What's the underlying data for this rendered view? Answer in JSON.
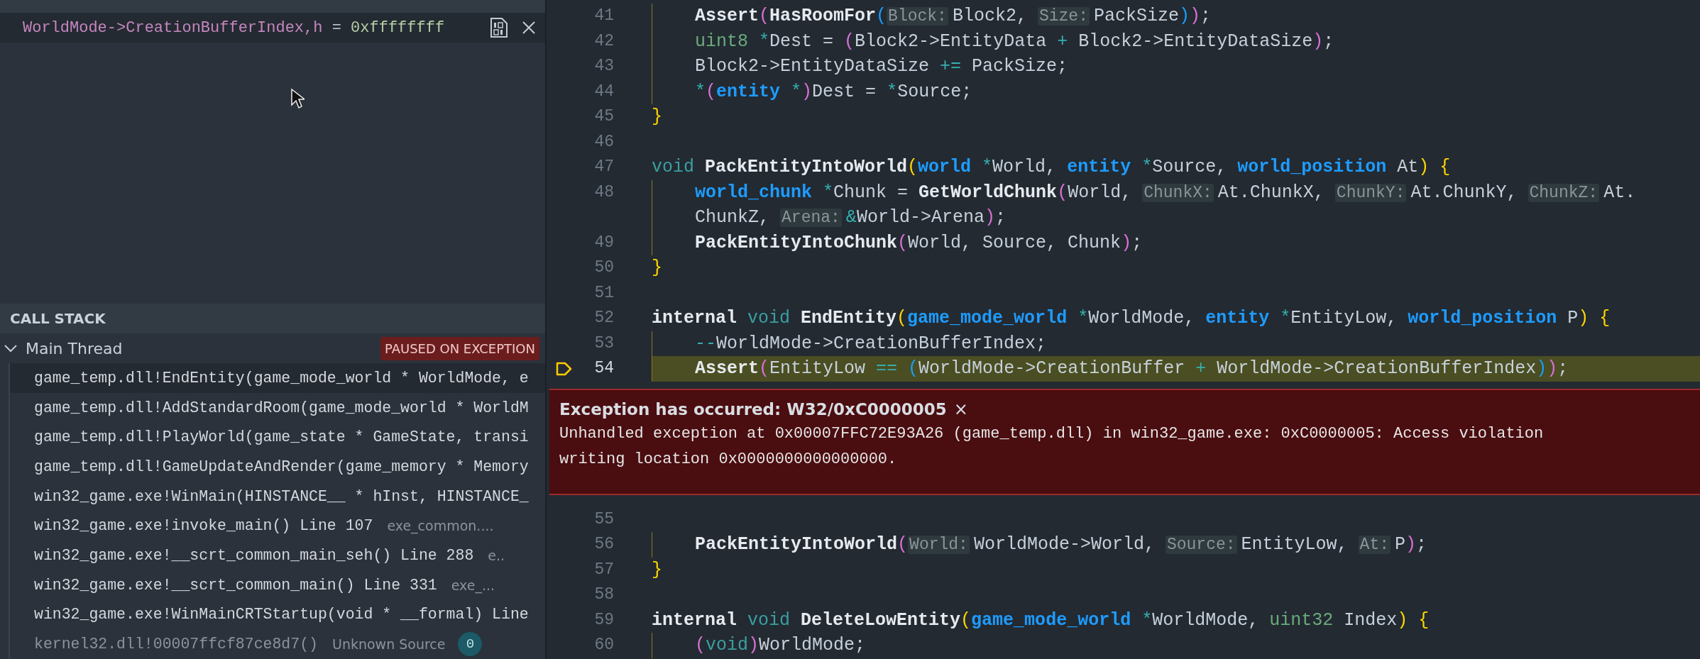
{
  "watch": {
    "expression": "WorldMode->CreationBufferIndex,h",
    "separator": "=",
    "value": "0xffffffff"
  },
  "call_stack": {
    "title": "CALL STACK",
    "threads": [
      {
        "name": "Main Thread",
        "expanded": true,
        "status": "PAUSED ON EXCEPTION",
        "frames": [
          {
            "name": "game_temp.dll!EndEntity(game_mode_world * WorldMode, e",
            "selected": true,
            "deemphasized": false
          },
          {
            "name": "game_temp.dll!AddStandardRoom(game_mode_world * WorldM",
            "selected": false,
            "deemphasized": false
          },
          {
            "name": "game_temp.dll!PlayWorld(game_state * GameState, transi",
            "selected": false,
            "deemphasized": false
          },
          {
            "name": "game_temp.dll!GameUpdateAndRender(game_memory * Memory",
            "selected": false,
            "deemphasized": false
          },
          {
            "name": "win32_game.exe!WinMain(HINSTANCE__ * hInst, HINSTANCE_",
            "selected": false,
            "deemphasized": false
          },
          {
            "name": "win32_game.exe!invoke_main() Line 107",
            "source": "exe_common....",
            "selected": false,
            "deemphasized": false
          },
          {
            "name": "win32_game.exe!__scrt_common_main_seh() Line 288",
            "source": "e..",
            "selected": false,
            "deemphasized": false
          },
          {
            "name": "win32_game.exe!__scrt_common_main() Line 331",
            "source": "exe_...",
            "selected": false,
            "deemphasized": false
          },
          {
            "name": "win32_game.exe!WinMainCRTStartup(void * __formal) Line",
            "selected": false,
            "deemphasized": false
          },
          {
            "name": "kernel32.dll!00007ffcf87ce8d7()",
            "source": "Unknown Source",
            "badge": "0",
            "selected": false,
            "deemphasized": true
          }
        ]
      }
    ]
  },
  "editor": {
    "lines": [
      {
        "number": "41",
        "tokens": [
          {
            "kind": "fn",
            "text": "    Assert"
          },
          {
            "kind": "p2",
            "text": "("
          },
          {
            "kind": "fn",
            "text": "HasRoomFor"
          },
          {
            "kind": "p3",
            "text": "("
          },
          {
            "kind": "hint",
            "text": "Block:"
          },
          {
            "kind": "plain",
            "text": "Block2, "
          },
          {
            "kind": "hint",
            "text": "Size:"
          },
          {
            "kind": "plain",
            "text": "PackSize"
          },
          {
            "kind": "p3",
            "text": ")"
          },
          {
            "kind": "p2",
            "text": ")"
          },
          {
            "kind": "plain",
            "text": ";"
          }
        ]
      },
      {
        "number": "42",
        "tokens": [
          {
            "kind": "prim",
            "text": "    uint8"
          },
          {
            "kind": "op",
            "text": " *"
          },
          {
            "kind": "plain",
            "text": "Dest = "
          },
          {
            "kind": "p2",
            "text": "("
          },
          {
            "kind": "plain",
            "text": "Block2->EntityData "
          },
          {
            "kind": "op",
            "text": "+"
          },
          {
            "kind": "plain",
            "text": " Block2->EntityDataSize"
          },
          {
            "kind": "p2",
            "text": ")"
          },
          {
            "kind": "plain",
            "text": ";"
          }
        ]
      },
      {
        "number": "43",
        "tokens": [
          {
            "kind": "plain",
            "text": "    Block2->EntityDataSize "
          },
          {
            "kind": "op",
            "text": "+="
          },
          {
            "kind": "plain",
            "text": " PackSize;"
          }
        ]
      },
      {
        "number": "44",
        "tokens": [
          {
            "kind": "op",
            "text": "    *"
          },
          {
            "kind": "p2",
            "text": "("
          },
          {
            "kind": "type",
            "text": "entity"
          },
          {
            "kind": "op",
            "text": " *"
          },
          {
            "kind": "p2",
            "text": ")"
          },
          {
            "kind": "plain",
            "text": "Dest = "
          },
          {
            "kind": "op",
            "text": "*"
          },
          {
            "kind": "plain",
            "text": "Source;"
          }
        ]
      },
      {
        "number": "45",
        "tokens": [
          {
            "kind": "p1",
            "text": "}"
          }
        ]
      },
      {
        "number": "46"
      },
      {
        "number": "47",
        "tokens": [
          {
            "kind": "void",
            "text": "void "
          },
          {
            "kind": "fn",
            "text": "PackEntityIntoWorld"
          },
          {
            "kind": "p1",
            "text": "("
          },
          {
            "kind": "type",
            "text": "world"
          },
          {
            "kind": "op",
            "text": " *"
          },
          {
            "kind": "plain",
            "text": "World, "
          },
          {
            "kind": "type",
            "text": "entity"
          },
          {
            "kind": "op",
            "text": " *"
          },
          {
            "kind": "plain",
            "text": "Source, "
          },
          {
            "kind": "type",
            "text": "world_position"
          },
          {
            "kind": "plain",
            "text": " At"
          },
          {
            "kind": "p1",
            "text": ")"
          },
          {
            "kind": "p1",
            "text": " {"
          }
        ]
      },
      {
        "number": "48",
        "tokens": [
          {
            "kind": "type",
            "text": "    world_chunk"
          },
          {
            "kind": "op",
            "text": " *"
          },
          {
            "kind": "plain",
            "text": "Chunk = "
          },
          {
            "kind": "fn",
            "text": "GetWorldChunk"
          },
          {
            "kind": "p2",
            "text": "("
          },
          {
            "kind": "plain",
            "text": "World, "
          },
          {
            "kind": "hint",
            "text": "ChunkX:"
          },
          {
            "kind": "plain",
            "text": "At.ChunkX, "
          },
          {
            "kind": "hint",
            "text": "ChunkY:"
          },
          {
            "kind": "plain",
            "text": "At.ChunkY, "
          },
          {
            "kind": "hint",
            "text": "ChunkZ:"
          },
          {
            "kind": "plain",
            "text": "At."
          }
        ],
        "continuation": [
          {
            "kind": "plain",
            "text": "    ChunkZ, "
          },
          {
            "kind": "hint",
            "text": "Arena:"
          },
          {
            "kind": "op",
            "text": "&"
          },
          {
            "kind": "plain",
            "text": "World->Arena"
          },
          {
            "kind": "p2",
            "text": ")"
          },
          {
            "kind": "plain",
            "text": ";"
          }
        ]
      },
      {
        "number": "49",
        "tokens": [
          {
            "kind": "fn",
            "text": "    PackEntityIntoChunk"
          },
          {
            "kind": "p2",
            "text": "("
          },
          {
            "kind": "plain",
            "text": "World, Source, Chunk"
          },
          {
            "kind": "p2",
            "text": ")"
          },
          {
            "kind": "plain",
            "text": ";"
          }
        ]
      },
      {
        "number": "50",
        "tokens": [
          {
            "kind": "p1",
            "text": "}"
          }
        ]
      },
      {
        "number": "51"
      },
      {
        "number": "52",
        "tokens": [
          {
            "kind": "kw",
            "text": "internal "
          },
          {
            "kind": "void",
            "text": "void "
          },
          {
            "kind": "fn",
            "text": "EndEntity"
          },
          {
            "kind": "p1",
            "text": "("
          },
          {
            "kind": "type",
            "text": "game_mode_world"
          },
          {
            "kind": "op",
            "text": " *"
          },
          {
            "kind": "plain",
            "text": "WorldMode, "
          },
          {
            "kind": "type",
            "text": "entity"
          },
          {
            "kind": "op",
            "text": " *"
          },
          {
            "kind": "plain",
            "text": "EntityLow, "
          },
          {
            "kind": "type",
            "text": "world_position"
          },
          {
            "kind": "plain",
            "text": " P"
          },
          {
            "kind": "p1",
            "text": ")"
          },
          {
            "kind": "p1",
            "text": " {"
          }
        ]
      },
      {
        "number": "53",
        "tokens": [
          {
            "kind": "op",
            "text": "    --"
          },
          {
            "kind": "plain",
            "text": "WorldMode->CreationBufferIndex;"
          }
        ]
      },
      {
        "number": "54",
        "exception_here": true,
        "tokens": [
          {
            "kind": "fn",
            "text": "    Assert"
          },
          {
            "kind": "p2",
            "text": "("
          },
          {
            "kind": "plain",
            "text": "EntityLow "
          },
          {
            "kind": "op",
            "text": "=="
          },
          {
            "kind": "p3",
            "text": " ("
          },
          {
            "kind": "plain",
            "text": "WorldMode->CreationBuffer "
          },
          {
            "kind": "op",
            "text": "+"
          },
          {
            "kind": "plain",
            "text": " WorldMode->CreationBufferIndex"
          },
          {
            "kind": "p3",
            "text": ")"
          },
          {
            "kind": "p2",
            "text": ")"
          },
          {
            "kind": "plain",
            "text": ";"
          }
        ]
      },
      {
        "number": "55"
      },
      {
        "number": "56",
        "tokens": [
          {
            "kind": "fn",
            "text": "    PackEntityIntoWorld"
          },
          {
            "kind": "p2",
            "text": "("
          },
          {
            "kind": "hint",
            "text": "World:"
          },
          {
            "kind": "plain",
            "text": "WorldMode->World, "
          },
          {
            "kind": "hint",
            "text": "Source:"
          },
          {
            "kind": "plain",
            "text": "EntityLow, "
          },
          {
            "kind": "hint",
            "text": "At:"
          },
          {
            "kind": "plain",
            "text": "P"
          },
          {
            "kind": "p2",
            "text": ")"
          },
          {
            "kind": "plain",
            "text": ";"
          }
        ]
      },
      {
        "number": "57",
        "tokens": [
          {
            "kind": "p1",
            "text": "}"
          }
        ]
      },
      {
        "number": "58"
      },
      {
        "number": "59",
        "tokens": [
          {
            "kind": "kw",
            "text": "internal "
          },
          {
            "kind": "void",
            "text": "void "
          },
          {
            "kind": "fn",
            "text": "DeleteLowEntity"
          },
          {
            "kind": "p1",
            "text": "("
          },
          {
            "kind": "type",
            "text": "game_mode_world"
          },
          {
            "kind": "op",
            "text": " *"
          },
          {
            "kind": "plain",
            "text": "WorldMode, "
          },
          {
            "kind": "prim",
            "text": "uint32"
          },
          {
            "kind": "plain",
            "text": " Index"
          },
          {
            "kind": "p1",
            "text": ")"
          },
          {
            "kind": "p1",
            "text": " {"
          }
        ]
      },
      {
        "number": "60",
        "tokens": [
          {
            "kind": "p2",
            "text": "    ("
          },
          {
            "kind": "void",
            "text": "void"
          },
          {
            "kind": "p2",
            "text": ")"
          },
          {
            "kind": "plain",
            "text": "WorldMode;"
          }
        ]
      }
    ],
    "exception": {
      "title": "Exception has occurred: W32/0xC0000005",
      "close": "×",
      "message_lines": [
        "Unhandled exception at 0x00007FFC72E93A26 (game_temp.dll) in win32_game.exe: 0xC0000005: Access violation",
        "writing location 0x0000000000000000."
      ]
    }
  }
}
